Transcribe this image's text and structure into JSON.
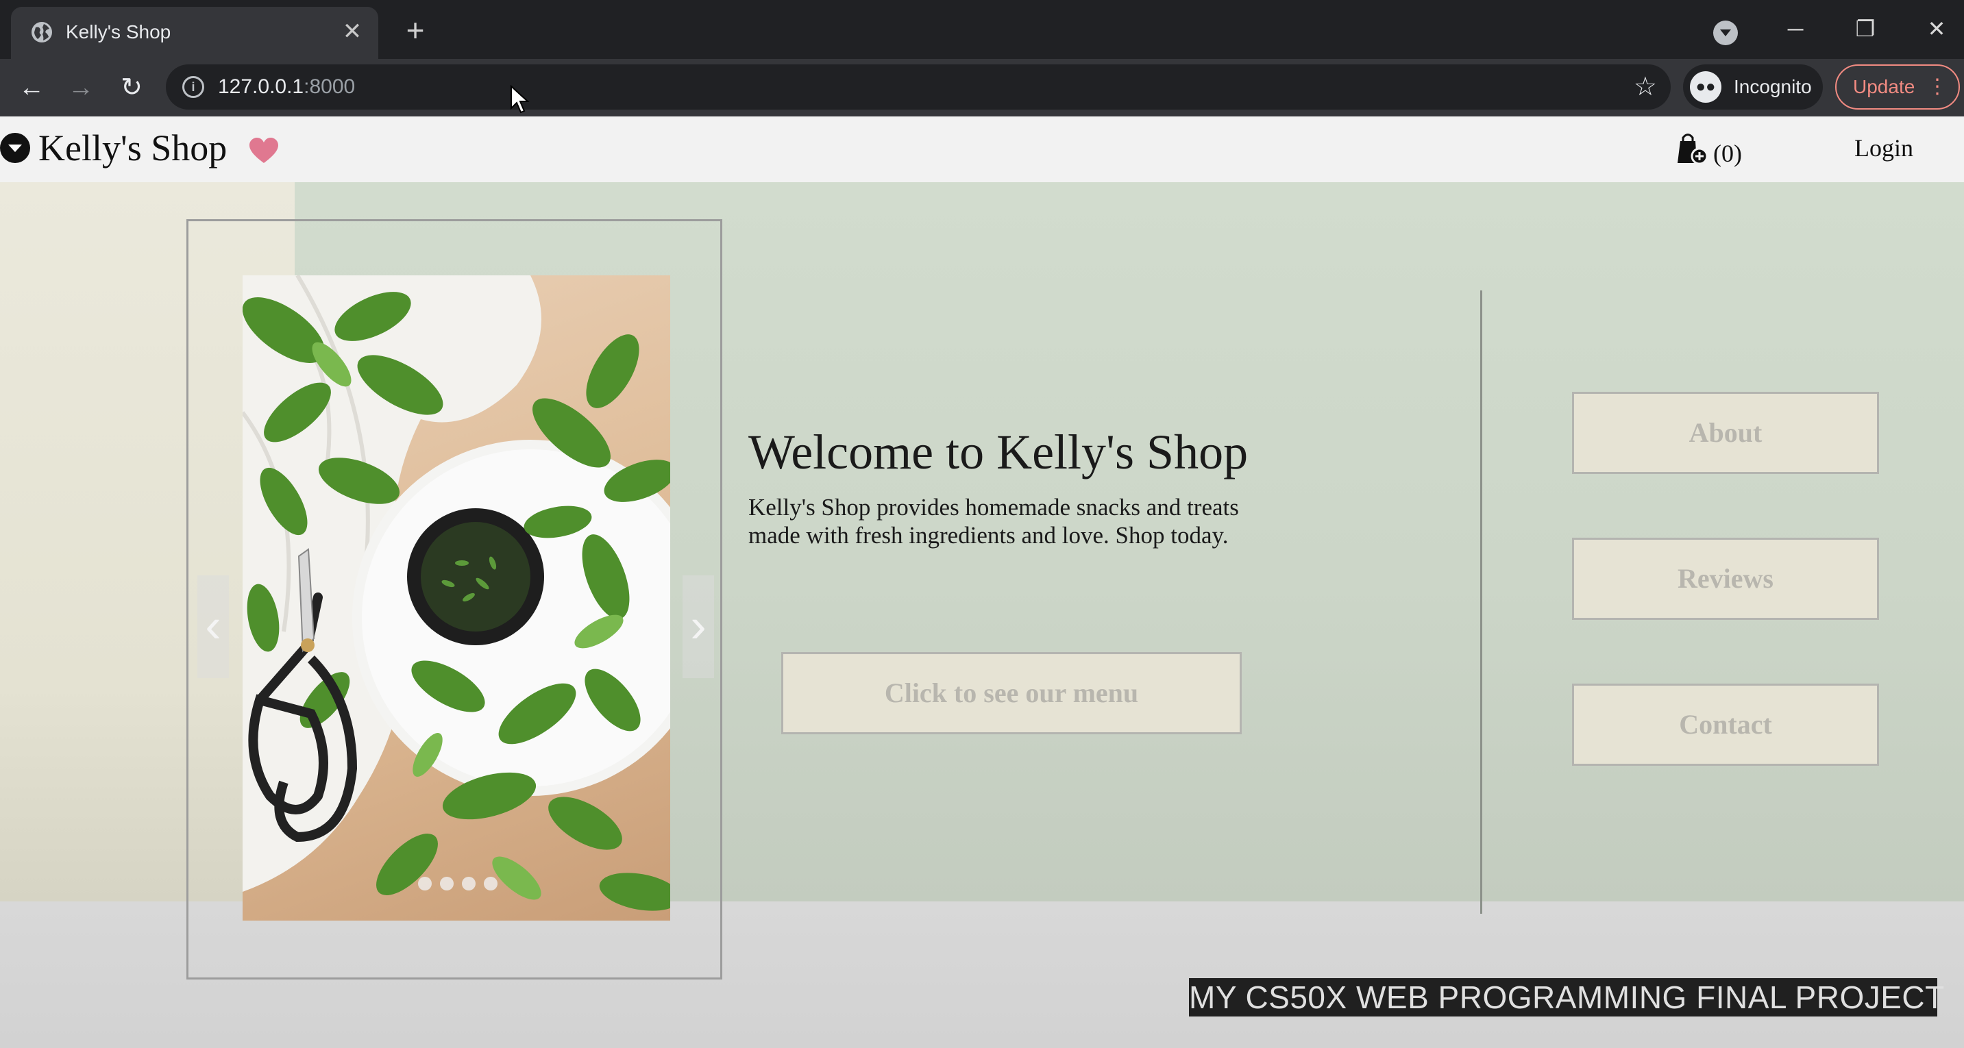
{
  "browser": {
    "tab_title": "Kelly's Shop",
    "tab_close": "✕",
    "new_tab": "+",
    "url_host": "127.0.0.1",
    "url_port": ":8000",
    "incognito_label": "Incognito",
    "update_label": "Update",
    "window_controls": {
      "minimize": "─",
      "restore": "❐",
      "close": "✕"
    },
    "nav": {
      "back": "←",
      "forward": "→",
      "reload": "↻"
    },
    "star": "☆",
    "menu": "⋮"
  },
  "site": {
    "brand": "Kelly's Shop",
    "cart_count": "(0)",
    "login": "Login"
  },
  "hero": {
    "welcome": "Welcome to Kelly's Shop",
    "tagline": "Kelly's Shop provides homemade snacks and treats made with fresh ingredients and love. Shop today.",
    "menu_button": "Click to see our menu",
    "side_buttons": {
      "about": "About",
      "reviews": "Reviews",
      "contact": "Contact"
    },
    "carousel": {
      "prev": "‹",
      "next": "›"
    }
  },
  "caption": "MY CS50X WEB PROGRAMMING FINAL PROJECT",
  "colors": {
    "hero_green": "#d2dcce",
    "strip_beige": "#ebe9dc",
    "button_fill": "#e6e3d4",
    "button_text": "#b8b6ae",
    "chrome_dark": "#202124",
    "update_red": "#f28b82",
    "heart_pink": "#e07890"
  }
}
